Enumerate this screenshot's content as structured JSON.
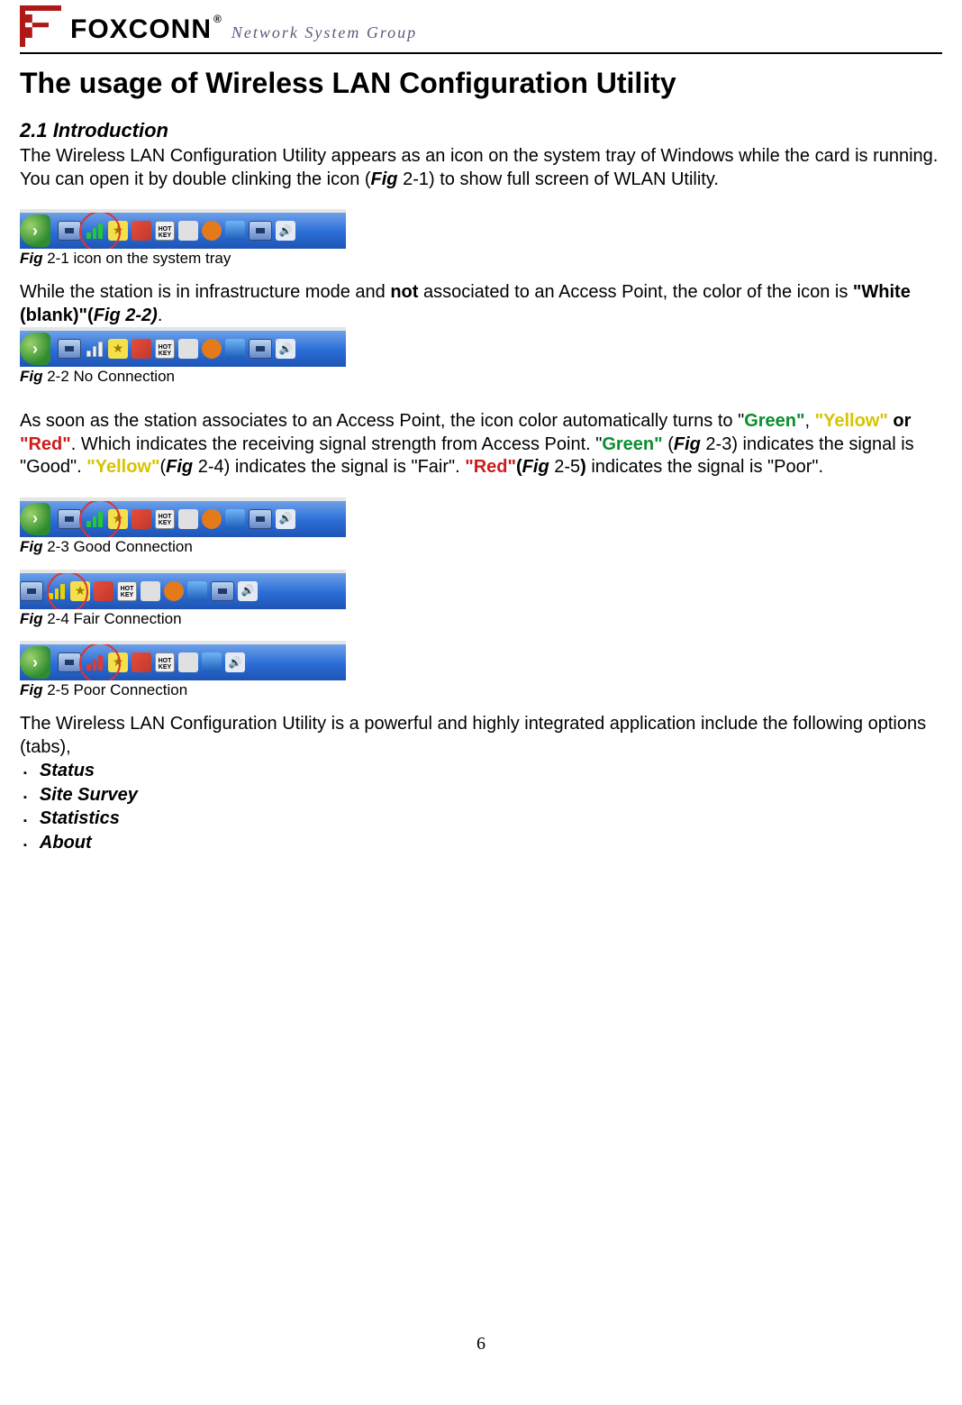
{
  "logo": {
    "brand": "FOXCONN",
    "reg": "®",
    "subtitle": "Network System Group"
  },
  "title": "The usage of Wireless LAN Configuration Utility",
  "section21": {
    "heading": "2.1 Introduction",
    "para1_a": "The Wireless LAN Configuration Utility appears as an icon on the system tray of Windows while the card is running. You can open it by double clinking the icon (",
    "para1_b": "Fig",
    "para1_c": " 2-1) to show full screen of WLAN Utility."
  },
  "figs": {
    "f21_pre": "Fig",
    "f21_txt": " 2-1 icon on the system tray",
    "f22_pre": "Fig",
    "f22_txt": " 2-2 No Connection",
    "f23_pre": "Fig",
    "f23_txt": " 2-3 Good Connection",
    "f24_pre": "Fig",
    "f24_txt": " 2-4 Fair Connection",
    "f25_pre": "Fig",
    "f25_txt": " 2-5 Poor Connection"
  },
  "para2": {
    "a": "While the station is in infrastructure mode and ",
    "not": "not",
    "b": " associated to an Access Point, the color of the icon is ",
    "white": "\"White (blank)\"",
    "c": "(",
    "fig22": "Fig 2-2)",
    "d": "."
  },
  "para3": {
    "a": "As soon as the station associates to an Access Point, the icon color automatically turns to \"",
    "green1": "Green\"",
    "b": ", ",
    "yellow1": "\"Yellow\"",
    "c": " or ",
    "red1": "\"Red\"",
    "d": ". Which indicates the receiving signal strength from Access Point. \"",
    "green2": "Green\"",
    "e": " (",
    "fig23a": "Fig",
    "fig23b": " 2-3) indicates the signal is \"Good\". ",
    "yellow2": "\"Yellow\"",
    "f": "(",
    "fig24a": "Fig",
    "fig24b": " 2-4) indicates the signal is \"Fair\". ",
    "red2": "\"Red\"",
    "g": "(",
    "fig25a": "Fig",
    "fig25b": " 2-5",
    "h": ") ",
    "i": "indicates the signal is \"Poor\"."
  },
  "para4": "The Wireless LAN Configuration Utility is a powerful and highly integrated application include the following options (tabs),",
  "tabs": [
    "Status",
    "Site Survey",
    "Statistics",
    "About"
  ],
  "pagenum": "6",
  "icon_labels": {
    "hotkey": "HOT KEY"
  }
}
